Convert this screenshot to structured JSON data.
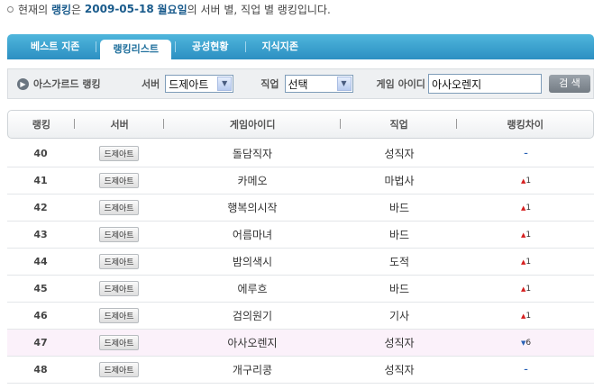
{
  "notice": {
    "prefix": "현재의",
    "ranking_word": "랭킹",
    "particle": "은",
    "date": "2009-05-18",
    "weekday": "월요일",
    "suffix": "의 서버 별, 직업 별 랭킹입니다."
  },
  "tabs": [
    {
      "label": "베스트 지존",
      "active": false
    },
    {
      "label": "랭킹리스트",
      "active": true
    },
    {
      "label": "공성현황",
      "active": false
    },
    {
      "label": "지식지존",
      "active": false
    }
  ],
  "filter": {
    "title": "아스가르드 랭킹",
    "server_label": "서버",
    "server_value": "드제아트",
    "job_label": "직업",
    "job_value": "선택",
    "id_label": "게임 아이디",
    "id_value": "아사오렌지",
    "search_label": "검 색"
  },
  "table": {
    "headers": [
      "랭킹",
      "서버",
      "게임아이디",
      "직업",
      "랭킹차이"
    ],
    "rows": [
      {
        "rank": "40",
        "server": "드제아트",
        "id": "돌담직자",
        "job": "성직자",
        "diff_dir": "same",
        "diff_symbol": "–",
        "diff_value": ""
      },
      {
        "rank": "41",
        "server": "드제아트",
        "id": "카메오",
        "job": "마법사",
        "diff_dir": "up",
        "diff_symbol": "▲",
        "diff_value": "1"
      },
      {
        "rank": "42",
        "server": "드제아트",
        "id": "행복의시작",
        "job": "바드",
        "diff_dir": "up",
        "diff_symbol": "▲",
        "diff_value": "1"
      },
      {
        "rank": "43",
        "server": "드제아트",
        "id": "어름마녀",
        "job": "바드",
        "diff_dir": "up",
        "diff_symbol": "▲",
        "diff_value": "1"
      },
      {
        "rank": "44",
        "server": "드제아트",
        "id": "밤의색시",
        "job": "도적",
        "diff_dir": "up",
        "diff_symbol": "▲",
        "diff_value": "1"
      },
      {
        "rank": "45",
        "server": "드제아트",
        "id": "에루흐",
        "job": "바드",
        "diff_dir": "up",
        "diff_symbol": "▲",
        "diff_value": "1"
      },
      {
        "rank": "46",
        "server": "드제아트",
        "id": "검의원기",
        "job": "기사",
        "diff_dir": "up",
        "diff_symbol": "▲",
        "diff_value": "1"
      },
      {
        "rank": "47",
        "server": "드제아트",
        "id": "아사오렌지",
        "job": "성직자",
        "diff_dir": "down",
        "diff_symbol": "▼",
        "diff_value": "6",
        "highlight": true
      },
      {
        "rank": "48",
        "server": "드제아트",
        "id": "개구리콩",
        "job": "성직자",
        "diff_dir": "same",
        "diff_symbol": "–",
        "diff_value": ""
      }
    ]
  },
  "colors": {
    "tab_bar": "#2c8fc2",
    "highlight_row": "#fbf1fa",
    "up": "#d62020",
    "down": "#2a62b6"
  },
  "icons": {
    "filter_title": "circle-arrow-icon",
    "select_arrow": "chevron-down-icon"
  }
}
